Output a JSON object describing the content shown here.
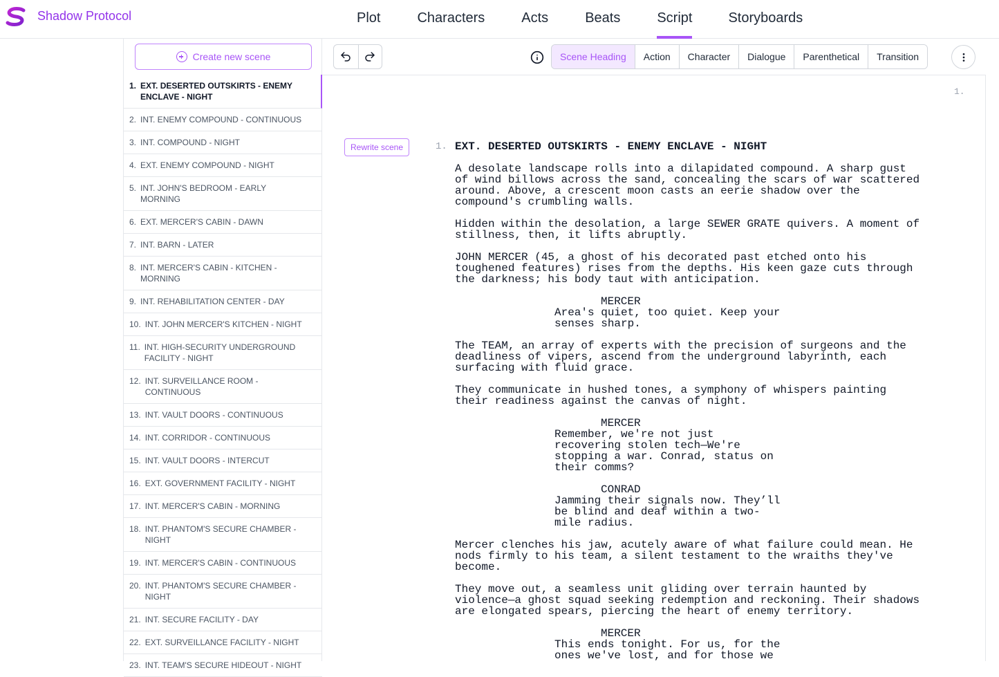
{
  "app": {
    "title": "Shadow Protocol"
  },
  "nav": {
    "tabs": [
      {
        "label": "Plot"
      },
      {
        "label": "Characters"
      },
      {
        "label": "Acts"
      },
      {
        "label": "Beats"
      },
      {
        "label": "Script",
        "active": true
      },
      {
        "label": "Storyboards"
      }
    ]
  },
  "sidebar": {
    "create_label": "Create new scene",
    "scenes": [
      {
        "num": "1.",
        "label": "EXT. DESERTED OUTSKIRTS - ENEMY ENCLAVE - NIGHT",
        "active": true
      },
      {
        "num": "2.",
        "label": "INT. ENEMY COMPOUND - CONTINUOUS"
      },
      {
        "num": "3.",
        "label": "INT. COMPOUND - NIGHT"
      },
      {
        "num": "4.",
        "label": "EXT. ENEMY COMPOUND - NIGHT"
      },
      {
        "num": "5.",
        "label": "INT. JOHN'S BEDROOM - EARLY MORNING"
      },
      {
        "num": "6.",
        "label": "EXT. MERCER'S CABIN - DAWN"
      },
      {
        "num": "7.",
        "label": "INT. BARN - LATER"
      },
      {
        "num": "8.",
        "label": "INT. MERCER'S CABIN - KITCHEN - MORNING"
      },
      {
        "num": "9.",
        "label": "INT. REHABILITATION CENTER - DAY"
      },
      {
        "num": "10.",
        "label": "INT. JOHN MERCER'S KITCHEN - NIGHT"
      },
      {
        "num": "11.",
        "label": "INT. HIGH-SECURITY UNDERGROUND FACILITY - NIGHT"
      },
      {
        "num": "12.",
        "label": "INT. SURVEILLANCE ROOM - CONTINUOUS"
      },
      {
        "num": "13.",
        "label": "INT. VAULT DOORS - CONTINUOUS"
      },
      {
        "num": "14.",
        "label": "INT. CORRIDOR - CONTINUOUS"
      },
      {
        "num": "15.",
        "label": "INT. VAULT DOORS - INTERCUT"
      },
      {
        "num": "16.",
        "label": "EXT. GOVERNMENT FACILITY - NIGHT"
      },
      {
        "num": "17.",
        "label": "INT. MERCER'S CABIN - MORNING"
      },
      {
        "num": "18.",
        "label": "INT. PHANTOM'S SECURE CHAMBER - NIGHT"
      },
      {
        "num": "19.",
        "label": "INT. MERCER'S CABIN - CONTINUOUS"
      },
      {
        "num": "20.",
        "label": "INT. PHANTOM'S SECURE CHAMBER - NIGHT"
      },
      {
        "num": "21.",
        "label": "INT. SECURE FACILITY - DAY"
      },
      {
        "num": "22.",
        "label": "EXT. SURVEILLANCE FACILITY - NIGHT"
      },
      {
        "num": "23.",
        "label": "INT. TEAM'S SECURE HIDEOUT - NIGHT"
      }
    ]
  },
  "toolbar": {
    "undo_icon": "undo-icon",
    "redo_icon": "redo-icon",
    "info_icon": "info-icon",
    "more_icon": "more-vertical-icon",
    "formats": [
      {
        "label": "Scene Heading",
        "active": true
      },
      {
        "label": "Action"
      },
      {
        "label": "Character"
      },
      {
        "label": "Dialogue"
      },
      {
        "label": "Parenthetical"
      },
      {
        "label": "Transition"
      }
    ]
  },
  "script": {
    "page_number": "1.",
    "rewrite_label": "Rewrite scene",
    "scene_number": "1.",
    "heading": "EXT. DESERTED OUTSKIRTS - ENEMY ENCLAVE - NIGHT",
    "blocks": [
      {
        "type": "action",
        "text": "A desolate landscape rolls into a dilapidated compound. A sharp gust of wind billows across the sand, concealing the scars of war scattered around. Above, a crescent moon casts an eerie shadow over the compound's crumbling walls."
      },
      {
        "type": "action",
        "text": "Hidden within the desolation, a large SEWER GRATE quivers. A moment of stillness, then, it lifts abruptly."
      },
      {
        "type": "action",
        "text": "JOHN MERCER (45, a ghost of his decorated past etched onto his toughened features) rises from the depths. His keen gaze cuts through the darkness; his body taut with anticipation."
      },
      {
        "type": "character",
        "text": "MERCER"
      },
      {
        "type": "dialogue",
        "text": "Area's quiet, too quiet. Keep your senses sharp."
      },
      {
        "type": "action",
        "text": "The TEAM, an array of experts with the precision of surgeons and the deadliness of vipers, ascend from the underground labyrinth, each surfacing with fluid grace."
      },
      {
        "type": "action",
        "text": "They communicate in hushed tones, a symphony of whispers painting their readiness against the canvas of night."
      },
      {
        "type": "character",
        "text": "MERCER"
      },
      {
        "type": "dialogue",
        "text": "Remember, we're not just recovering stolen tech—We're stopping a war. Conrad, status on their comms?"
      },
      {
        "type": "character",
        "text": "CONRAD"
      },
      {
        "type": "dialogue",
        "text": "Jamming their signals now. They’ll be blind and deaf within a two-mile radius."
      },
      {
        "type": "action",
        "text": "Mercer clenches his jaw, acutely aware of what failure could mean. He nods firmly to his team, a silent testament to the wraiths they've become."
      },
      {
        "type": "action",
        "text": "They move out, a seamless unit gliding over terrain haunted by violence—a ghost squad seeking redemption and reckoning. Their shadows are elongated spears, piercing the heart of enemy territory."
      },
      {
        "type": "character",
        "text": "MERCER"
      },
      {
        "type": "dialogue",
        "text": "This ends tonight. For us, for the ones we've lost, and for those we"
      }
    ]
  },
  "colors": {
    "accent": "#a855f7",
    "accent_light": "#f3e8ff",
    "border": "#e5e7eb"
  }
}
